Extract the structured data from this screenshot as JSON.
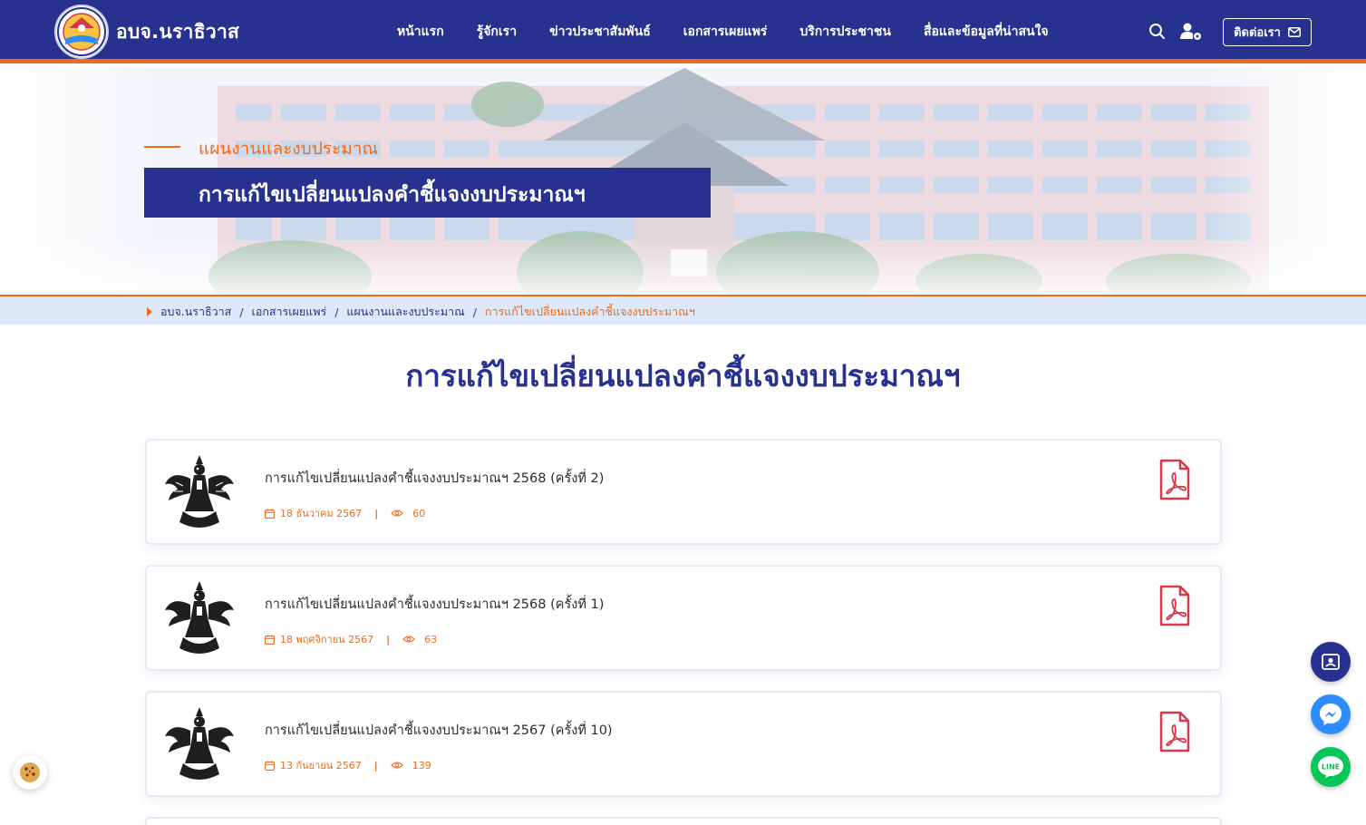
{
  "brand": {
    "name": "อบจ.นราธิวาส"
  },
  "nav": {
    "items": [
      {
        "label": "หน้าแรก"
      },
      {
        "label": "รู้จักเรา"
      },
      {
        "label": "ข่าวประชาสัมพันธ์"
      },
      {
        "label": "เอกสารเผยแพร่"
      },
      {
        "label": "บริการประชาชน"
      },
      {
        "label": "สื่อและข้อมูลที่น่าสนใจ"
      }
    ],
    "contact_label": "ติดต่อเรา"
  },
  "hero": {
    "eyebrow": "แผนงานและงบประมาณ",
    "title": "การแก้ไขเปลี่ยนแปลงคำชี้แจงงบประมาณฯ"
  },
  "breadcrumb": {
    "items": [
      "อบจ.นราธิวาส",
      "เอกสารเผยแพร่",
      "แผนงานและงบประมาณ"
    ],
    "current": "การแก้ไขเปลี่ยนแปลงคำชี้แจงงบประมาณฯ"
  },
  "page": {
    "title": "การแก้ไขเปลี่ยนแปลงคำชี้แจงงบประมาณฯ"
  },
  "documents": [
    {
      "title": "การแก้ไขเปลี่ยนแปลงคำชี้แจงงบประมาณฯ 2568 (ครั้งที่ 2)",
      "date": "18 ธันวาคม 2567",
      "views": "60"
    },
    {
      "title": "การแก้ไขเปลี่ยนแปลงคำชี้แจงงบประมาณฯ 2568 (ครั้งที่ 1)",
      "date": "18 พฤศจิกายน 2567",
      "views": "63"
    },
    {
      "title": "การแก้ไขเปลี่ยนแปลงคำชี้แจงงบประมาณฯ 2567 (ครั้งที่ 10)",
      "date": "13 กันยายน 2567",
      "views": "139"
    }
  ],
  "colors": {
    "primary": "#27318f",
    "accent": "#ef6a1a",
    "pdf": "#d63a4a",
    "messenger": "#2d8cff",
    "line": "#06c755"
  },
  "icons": {
    "search": "search-icon",
    "user_settings": "user-gear-icon",
    "mail": "mail-icon",
    "pdf": "pdf-icon",
    "calendar": "calendar-icon",
    "eye": "eye-icon"
  }
}
